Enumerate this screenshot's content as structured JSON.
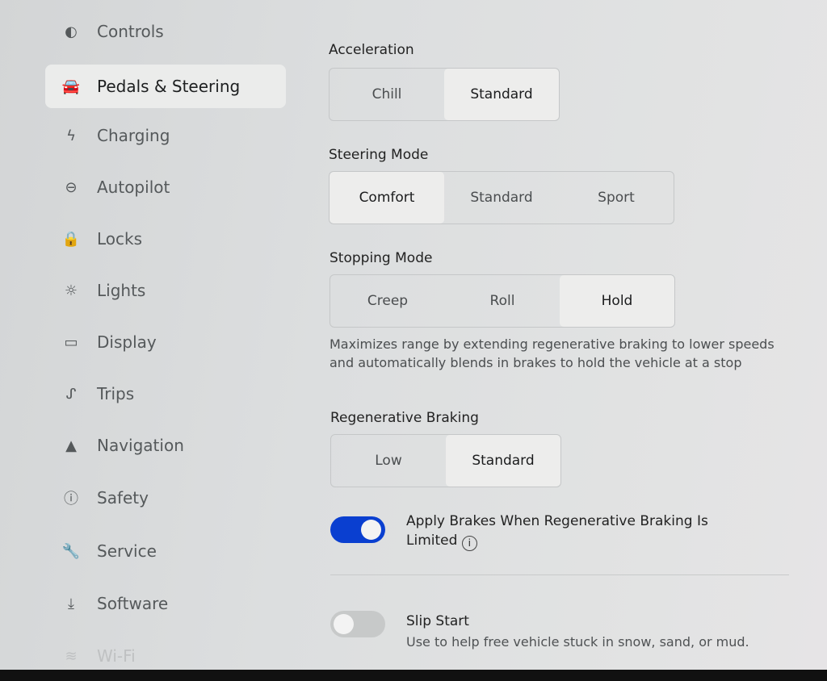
{
  "sidebar": {
    "items": [
      {
        "label": "Controls",
        "icon": "toggle-icon",
        "glyph": "◐"
      },
      {
        "label": "Pedals & Steering",
        "icon": "car-icon",
        "glyph": "🚘",
        "selected": true
      },
      {
        "label": "Charging",
        "icon": "lightning-icon",
        "glyph": "ϟ"
      },
      {
        "label": "Autopilot",
        "icon": "steering-wheel-icon",
        "glyph": "⊖"
      },
      {
        "label": "Locks",
        "icon": "lock-icon",
        "glyph": "🔒"
      },
      {
        "label": "Lights",
        "icon": "light-icon",
        "glyph": "☼"
      },
      {
        "label": "Display",
        "icon": "display-icon",
        "glyph": "▭"
      },
      {
        "label": "Trips",
        "icon": "trips-icon",
        "glyph": "ᔑ"
      },
      {
        "label": "Navigation",
        "icon": "navigation-arrow-icon",
        "glyph": "▲"
      },
      {
        "label": "Safety",
        "icon": "alert-circle-icon",
        "glyph": "ⓘ"
      },
      {
        "label": "Service",
        "icon": "wrench-icon",
        "glyph": "🔧"
      },
      {
        "label": "Software",
        "icon": "download-icon",
        "glyph": "⤓"
      },
      {
        "label": "Wi-Fi",
        "icon": "wifi-icon",
        "glyph": "≋"
      }
    ]
  },
  "main": {
    "acceleration": {
      "label": "Acceleration",
      "options": [
        "Chill",
        "Standard"
      ],
      "selected": "Standard"
    },
    "steering": {
      "label": "Steering Mode",
      "options": [
        "Comfort",
        "Standard",
        "Sport"
      ],
      "selected": "Comfort"
    },
    "stopping": {
      "label": "Stopping Mode",
      "options": [
        "Creep",
        "Roll",
        "Hold"
      ],
      "selected": "Hold",
      "description": "Maximizes range by extending regenerative braking to lower speeds and automatically blends in brakes to hold the vehicle at a stop"
    },
    "regen": {
      "label": "Regenerative Braking",
      "options": [
        "Low",
        "Standard"
      ],
      "selected": "Standard"
    },
    "apply_brakes": {
      "label": "Apply Brakes When Regenerative Braking Is Limited",
      "on": true,
      "color": "#0a3fd0"
    },
    "slip_start": {
      "label": "Slip Start",
      "description": "Use to help free vehicle stuck in snow, sand, or mud.",
      "on": false
    }
  }
}
